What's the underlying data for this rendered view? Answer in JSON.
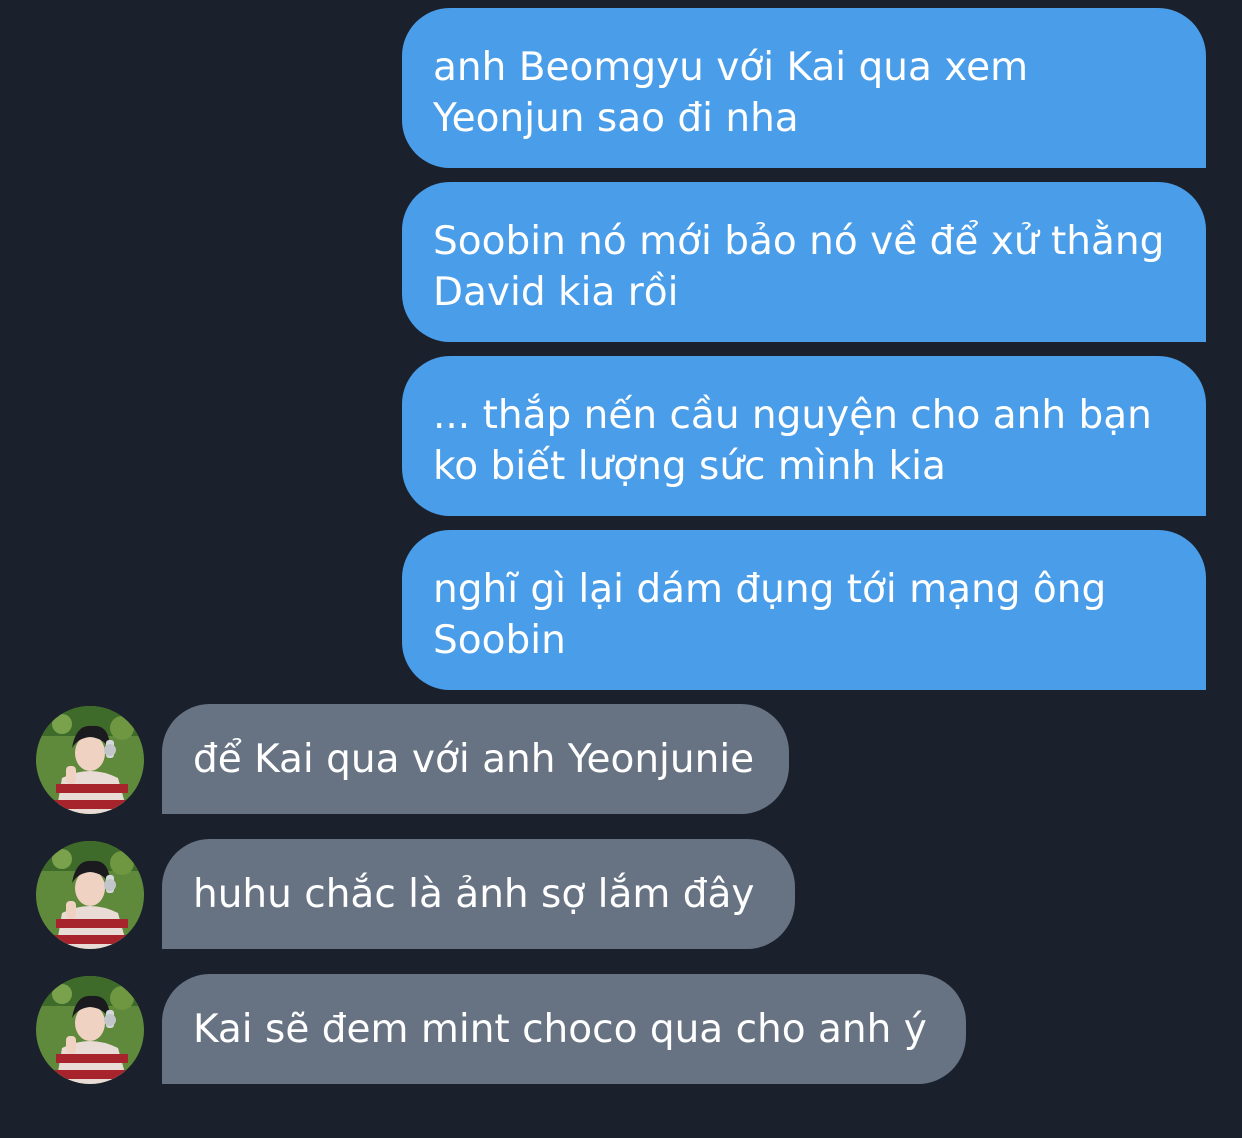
{
  "colors": {
    "background": "#1a212c",
    "outgoing_bubble": "#4a9de8",
    "incoming_bubble": "#677383",
    "text": "#ffffff"
  },
  "conversation": {
    "outgoing": [
      {
        "line1": "anh Beomgyu với Kai qua xem",
        "line2": "Yeonjun sao đi nha"
      },
      {
        "line1": "Soobin nó mới bảo nó về để xử thằng",
        "line2": "David kia rồi"
      },
      {
        "line1": "... thắp nến cầu nguyện cho anh bạn",
        "line2": "ko biết lượng sức mình kia"
      },
      {
        "line1": "nghĩ gì lại dám đụng tới mạng ông",
        "line2": "Soobin"
      }
    ],
    "incoming": [
      {
        "text": "để Kai qua với anh Yeonjunie",
        "avatar": "profile-photo"
      },
      {
        "text": "huhu chắc là ảnh sợ lắm đây",
        "avatar": "profile-photo"
      },
      {
        "text": "Kai sẽ đem mint choco qua cho anh ý",
        "avatar": "profile-photo"
      }
    ]
  }
}
